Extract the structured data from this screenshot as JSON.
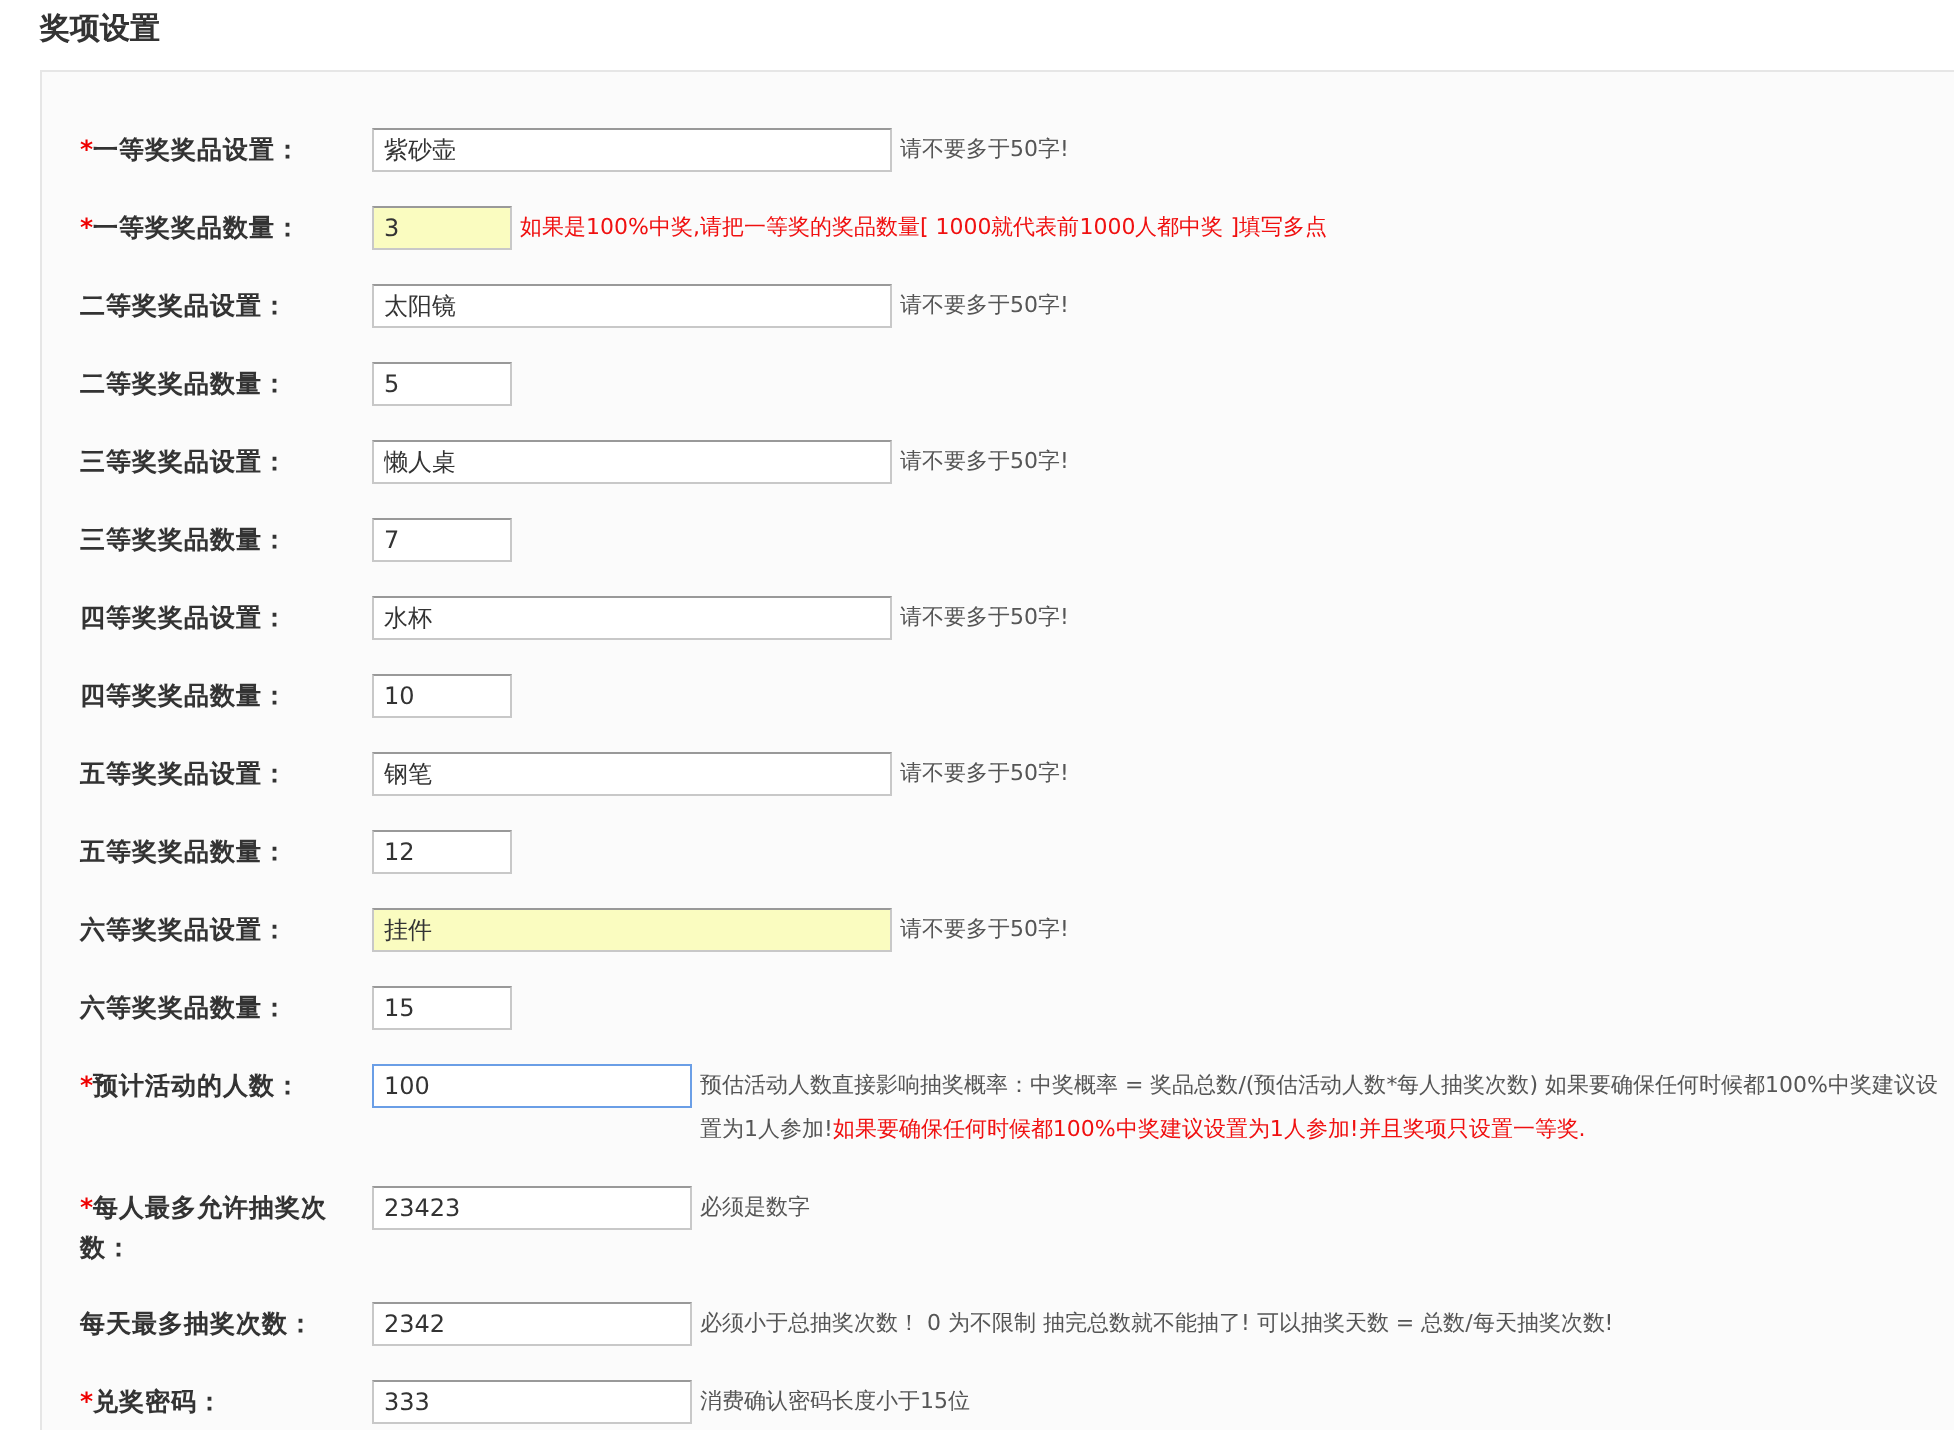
{
  "title": "奖项设置",
  "rows": [
    {
      "mark": "*",
      "label": "一等奖奖品设置：",
      "value": "紫砂壶",
      "kind": "long",
      "highlighted": false,
      "focused": false,
      "hint": [
        {
          "kind": "note",
          "text": "请不要多于50字!"
        }
      ]
    },
    {
      "mark": "*",
      "label": "一等奖奖品数量：",
      "value": "3",
      "kind": "short",
      "highlighted": true,
      "focused": false,
      "hint": [
        {
          "kind": "alert",
          "text": "如果是100%中奖,请把一等奖的奖品数量[ 1000就代表前1000人都中奖 ]填写多点"
        }
      ]
    },
    {
      "label": "二等奖奖品设置：",
      "value": "太阳镜",
      "kind": "long",
      "highlighted": false,
      "focused": false,
      "hint": [
        {
          "kind": "note",
          "text": "请不要多于50字!"
        }
      ]
    },
    {
      "label": "二等奖奖品数量：",
      "value": "5",
      "kind": "short",
      "highlighted": false,
      "focused": false
    },
    {
      "label": "三等奖奖品设置：",
      "value": "懒人桌",
      "kind": "long",
      "highlighted": false,
      "focused": false,
      "hint": [
        {
          "kind": "note",
          "text": "请不要多于50字!"
        }
      ]
    },
    {
      "label": "三等奖奖品数量：",
      "value": "7",
      "kind": "short",
      "highlighted": false,
      "focused": false
    },
    {
      "label": "四等奖奖品设置：",
      "value": "水杯",
      "kind": "long",
      "highlighted": false,
      "focused": false,
      "hint": [
        {
          "kind": "note",
          "text": "请不要多于50字!"
        }
      ]
    },
    {
      "label": "四等奖奖品数量：",
      "value": "10",
      "kind": "short",
      "highlighted": false,
      "focused": false
    },
    {
      "label": "五等奖奖品设置：",
      "value": "钢笔",
      "kind": "long",
      "highlighted": false,
      "focused": false,
      "hint": [
        {
          "kind": "note",
          "text": "请不要多于50字!"
        }
      ]
    },
    {
      "label": "五等奖奖品数量：",
      "value": "12",
      "kind": "short",
      "highlighted": false,
      "focused": false
    },
    {
      "label": "六等奖奖品设置：",
      "value": "挂件",
      "kind": "long",
      "highlighted": true,
      "focused": false,
      "hint": [
        {
          "kind": "note",
          "text": "请不要多于50字!"
        }
      ]
    },
    {
      "label": "六等奖奖品数量：",
      "value": "15",
      "kind": "short",
      "highlighted": false,
      "focused": false
    },
    {
      "mark": "*",
      "label": "预计活动的人数：",
      "value": "100",
      "kind": "medium",
      "highlighted": false,
      "focused": true,
      "hint": [
        {
          "kind": "note",
          "text": "预估活动人数直接影响抽奖概率：中奖概率 = 奖品总数/(预估活动人数*每人抽奖次数) 如果要确保任何时候都100%中奖建议设置为1人参加!"
        },
        {
          "kind": "alert",
          "text": "如果要确保任何时候都100%中奖建议设置为1人参加!并且奖项只设置一等奖."
        }
      ]
    },
    {
      "mark": "*",
      "label": "每人最多允许抽奖次数：",
      "value": "23423",
      "kind": "medium",
      "highlighted": false,
      "focused": false,
      "hint": [
        {
          "kind": "note",
          "text": "必须是数字"
        }
      ]
    },
    {
      "label": "每天最多抽奖次数：",
      "value": "2342",
      "kind": "medium",
      "highlighted": false,
      "focused": false,
      "hint": [
        {
          "kind": "note",
          "text": "必须小于总抽奖次数！ 0 为不限制 抽完总数就不能抽了! 可以抽奖天数 = 总数/每天抽奖次数!"
        }
      ]
    },
    {
      "mark": "*",
      "label": "兑奖密码：",
      "value": "333",
      "kind": "medium",
      "highlighted": false,
      "focused": false,
      "hint": [
        {
          "kind": "note",
          "text": "消费确认密码长度小于15位"
        }
      ]
    }
  ]
}
